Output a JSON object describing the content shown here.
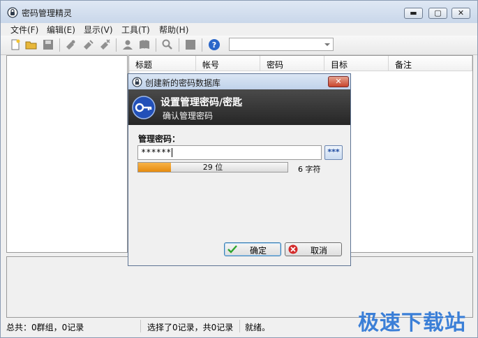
{
  "window": {
    "title": "密码管理精灵",
    "minimize": "▬",
    "maximize": "▢",
    "close": "✕"
  },
  "menu": [
    "文件(F)",
    "编辑(E)",
    "显示(V)",
    "工具(T)",
    "帮助(H)"
  ],
  "table": {
    "columns": [
      "标题",
      "帐号",
      "密码",
      "目标",
      "备注"
    ]
  },
  "status": {
    "summary": "总共：0群组，0记录",
    "selection": "选择了0记录，共0记录",
    "state": "就绪。"
  },
  "watermark": "极速下载站",
  "dialog": {
    "title": "创建新的密码数据库",
    "close": "✕",
    "banner_title": "设置管理密码/密匙",
    "banner_subtitle": "确认管理密码",
    "password_label": "管理密码：",
    "password_value": "******",
    "reveal_label": "***",
    "quality_text": "29 位",
    "quality_fraction": 0.22,
    "char_count": "6 字符",
    "ok_label": "确定",
    "cancel_label": "取消"
  },
  "colors": {
    "accent": "#3b7fd7",
    "quality_bar": "#e68b10",
    "banner": "#262626"
  }
}
